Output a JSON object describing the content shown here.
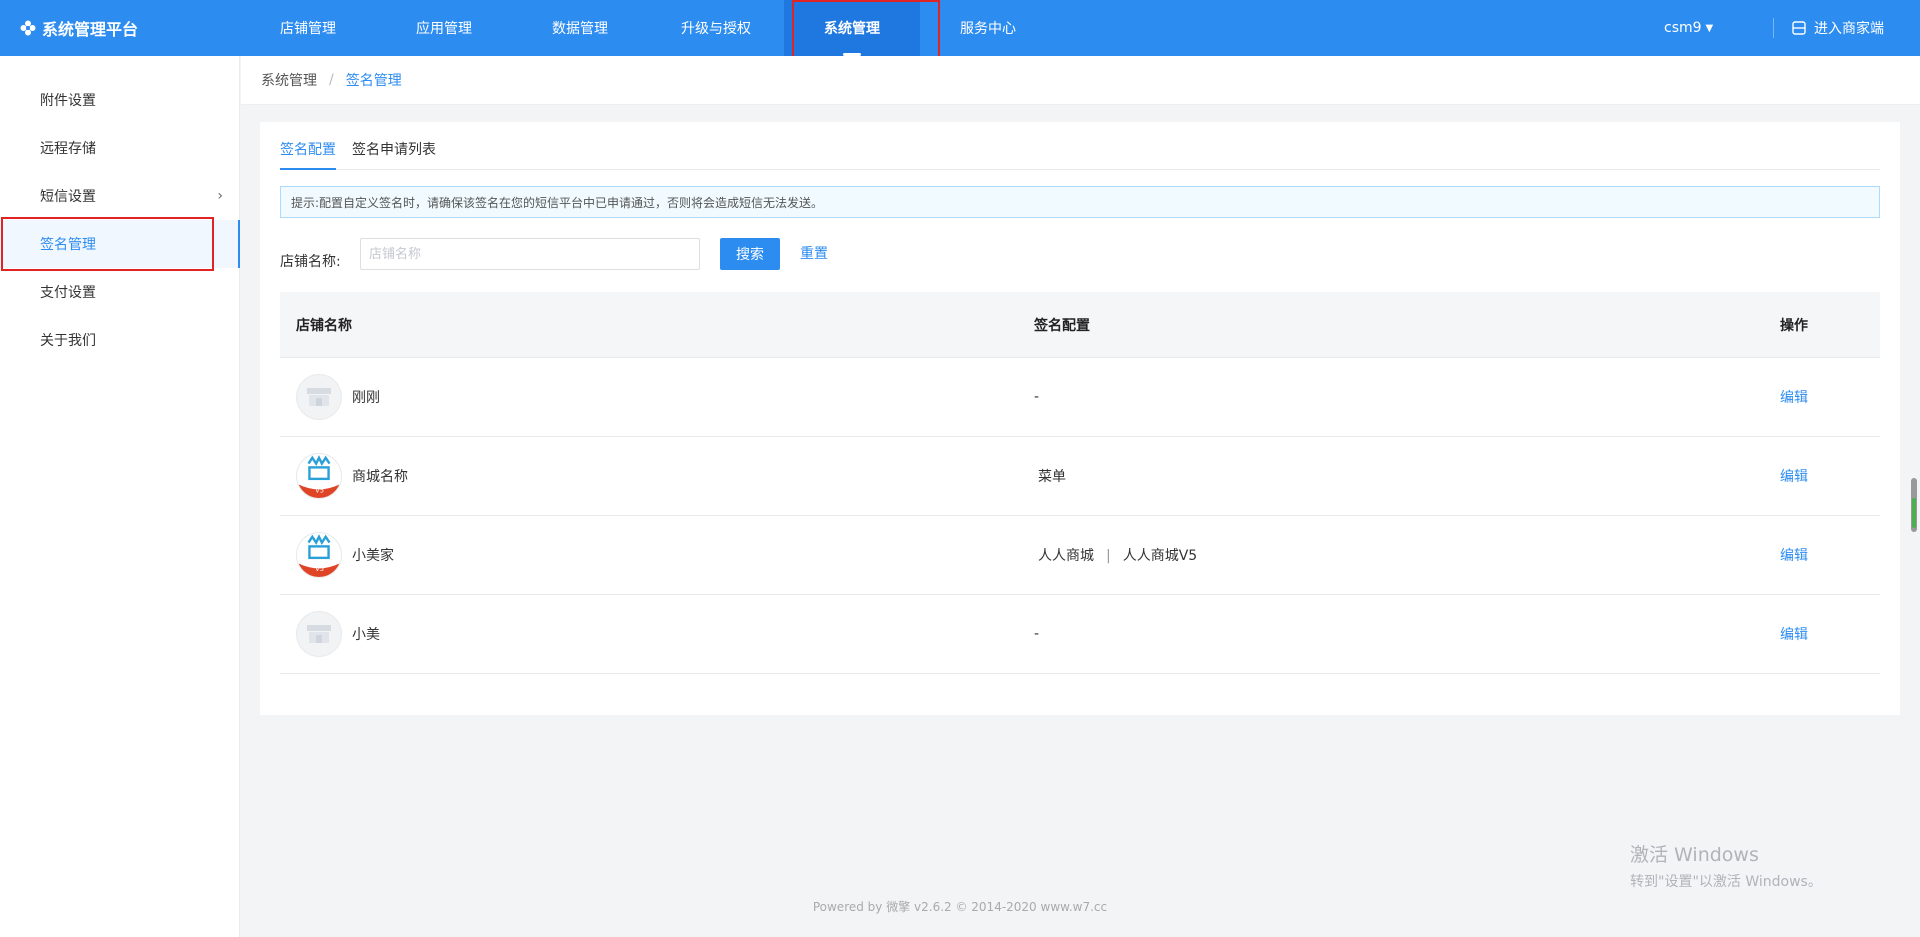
{
  "app": {
    "title": "系统管理平台"
  },
  "nav": {
    "items": [
      {
        "label": "店铺管理"
      },
      {
        "label": "应用管理"
      },
      {
        "label": "数据管理"
      },
      {
        "label": "升级与授权"
      },
      {
        "label": "系统管理",
        "active": true
      },
      {
        "label": "服务中心"
      }
    ],
    "user": "csm9",
    "enter_label": "进入商家端"
  },
  "sidebar": {
    "items": [
      {
        "label": "附件设置"
      },
      {
        "label": "远程存储"
      },
      {
        "label": "短信设置",
        "has_children": true
      },
      {
        "label": "签名管理",
        "active": true
      },
      {
        "label": "支付设置"
      },
      {
        "label": "关于我们"
      }
    ]
  },
  "breadcrumb": {
    "parent": "系统管理",
    "separator": "/",
    "current": "签名管理"
  },
  "tabs": [
    {
      "label": "签名配置",
      "active": true
    },
    {
      "label": "签名申请列表"
    }
  ],
  "notice": "提示:配置自定义签名时，请确保该签名在您的短信平台中已申请通过，否则将会造成短信无法发送。",
  "search": {
    "label": "店铺名称:",
    "placeholder": "店铺名称",
    "value": "",
    "search_label": "搜索",
    "reset_label": "重置"
  },
  "table": {
    "columns": [
      "店铺名称",
      "签名配置",
      "操作"
    ],
    "rows": [
      {
        "name": "刚刚",
        "avatar": "shop-placeholder-icon",
        "signature": "-",
        "action": "编辑"
      },
      {
        "name": "商城名称",
        "avatar": "mall-logo-icon",
        "signature": "菜单",
        "action": "编辑"
      },
      {
        "name": "小美家",
        "avatar": "mall-logo-icon",
        "signature_parts": [
          "人人商城",
          "人人商城V5"
        ],
        "signature_separator": "|",
        "action": "编辑"
      },
      {
        "name": "小美",
        "avatar": "shop-placeholder-icon",
        "signature": "-",
        "action": "编辑"
      }
    ]
  },
  "watermark": {
    "line1": "激活 Windows",
    "line2": "转到\"设置\"以激活 Windows。"
  },
  "footer": "Powered by 微擎 v2.6.2 © 2014-2020 www.w7.cc",
  "colors": {
    "primary": "#2d8cf0",
    "highlight": "#e02424"
  }
}
